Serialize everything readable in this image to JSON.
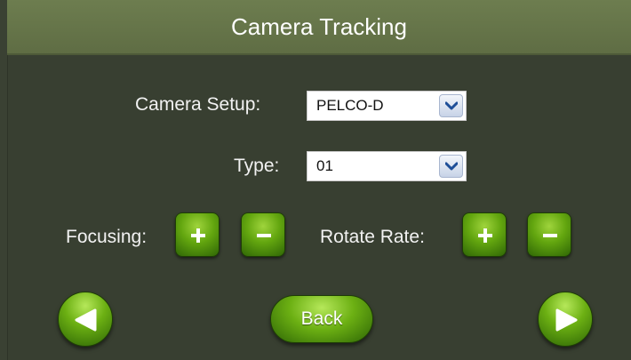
{
  "title": "Camera Tracking",
  "camera_setup": {
    "label": "Camera Setup:",
    "value": "PELCO-D"
  },
  "type": {
    "label": "Type:",
    "value": "01"
  },
  "focusing": {
    "label": "Focusing:",
    "increase_icon": "plus-icon",
    "decrease_icon": "minus-icon"
  },
  "rotate_rate": {
    "label": "Rotate Rate:",
    "increase_icon": "plus-icon",
    "decrease_icon": "minus-icon"
  },
  "nav": {
    "prev_icon": "arrow-left-icon",
    "back_label": "Back",
    "next_icon": "arrow-right-icon"
  },
  "colors": {
    "background": "#383f31",
    "title_bar": "#66764a",
    "button_green": "#63a60f",
    "select_arrow": "#1f4f98"
  }
}
